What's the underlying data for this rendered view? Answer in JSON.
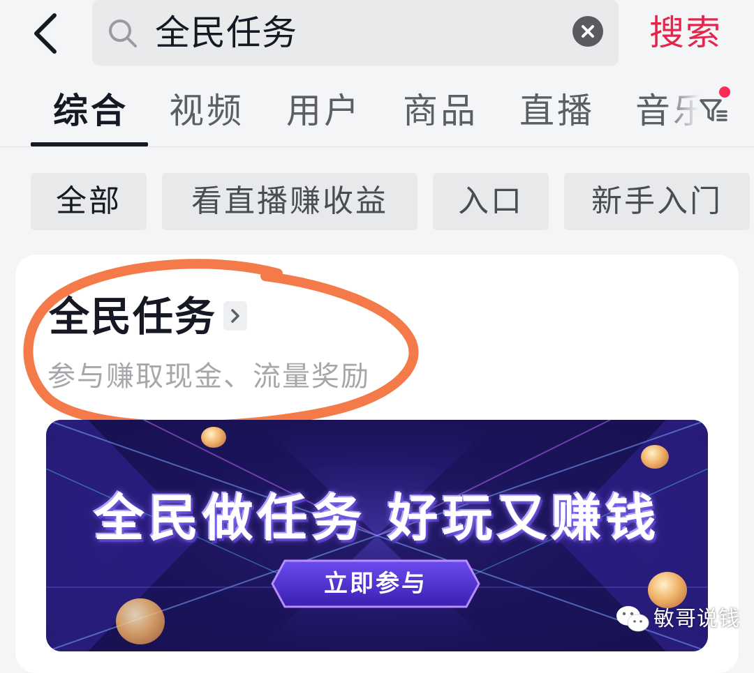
{
  "search": {
    "query": "全民任务",
    "submit_label": "搜索"
  },
  "tabs": [
    {
      "label": "综合",
      "active": true
    },
    {
      "label": "视频"
    },
    {
      "label": "用户"
    },
    {
      "label": "商品"
    },
    {
      "label": "直播"
    },
    {
      "label": "音乐"
    }
  ],
  "chips": [
    {
      "label": "全部",
      "selected": true
    },
    {
      "label": "看直播赚收益"
    },
    {
      "label": "入口"
    },
    {
      "label": "新手入门"
    }
  ],
  "result_card": {
    "title": "全民任务",
    "subtitle": "参与赚取现金、流量奖励",
    "banner": {
      "headline": "全民做任务 好玩又赚钱",
      "cta_label": "立即参与"
    }
  },
  "watermark": {
    "text": "敏哥说钱"
  },
  "colors": {
    "accent": "#e4264c",
    "annotation_ring": "#f47a4a",
    "banner_bg": "#22186b"
  },
  "icons": [
    "back-arrow-icon",
    "search-icon",
    "clear-icon",
    "filter-icon",
    "chevron-right-icon",
    "wechat-icon"
  ]
}
